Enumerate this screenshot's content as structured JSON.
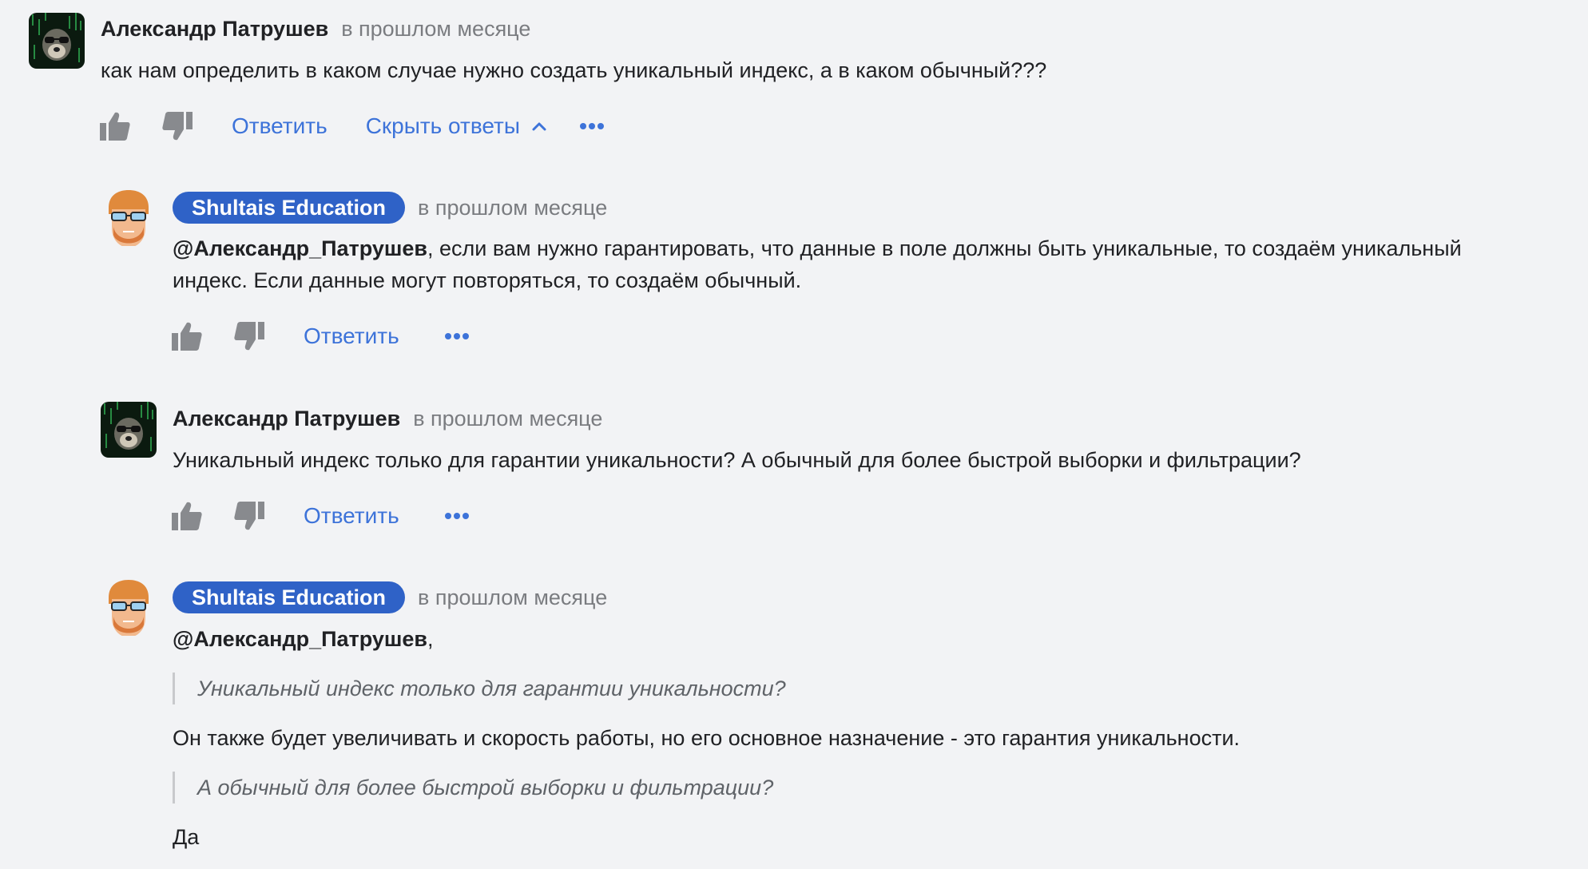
{
  "comments": [
    {
      "author": "Александр Патрушев",
      "time": "в прошлом месяце",
      "text": "как нам определить в каком случае нужно создать уникальный индекс, а в каком обычный???",
      "reply_label": "Ответить",
      "toggle_label": "Скрыть ответы"
    },
    {
      "author": "Shultais Education",
      "time": "в прошлом месяце",
      "mention": "@Александр_Патрушев",
      "line1": ", если вам нужно гарантировать, что данные в поле должны быть уникальные, то создаём уникальный",
      "line2": "индекс. Если данные могут повторяться, то создаём обычный.",
      "reply_label": "Ответить"
    },
    {
      "author": "Александр Патрушев",
      "time": "в прошлом месяце",
      "text": "Уникальный индекс только для гарантии уникальности? А обычный для более быстрой выборки и фильтрации?",
      "reply_label": "Ответить"
    },
    {
      "author": "Shultais Education",
      "time": "в прошлом месяце",
      "mention": "@Александр_Патрушев",
      "mention_suffix": ",",
      "quote1": "Уникальный индекс только для гарантии уникальности?",
      "answer1": "Он также будет увеличивать и скорость работы, но его основное назначение - это гарантия уникальности.",
      "quote2": "А обычный для более быстрой выборки и фильтрации?",
      "answer2": "Да"
    }
  ],
  "icons": {
    "like": "thumbs-up-icon",
    "dislike": "thumbs-down-icon",
    "more": "more-horizontal-icon",
    "chevron": "chevron-up-icon"
  },
  "colors": {
    "background": "#f2f3f5",
    "link": "#3d73d9",
    "badge": "#2f62c7",
    "icon": "#888a8e",
    "muted": "#7a7c80"
  }
}
